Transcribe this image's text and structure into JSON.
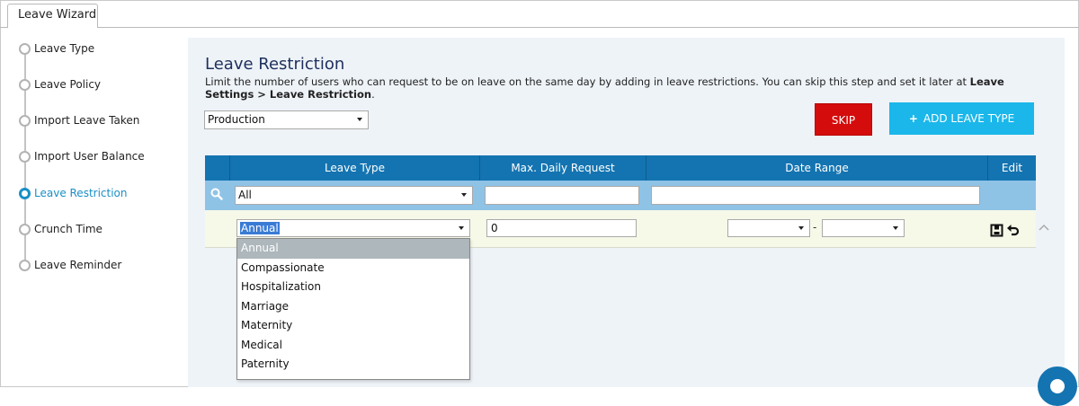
{
  "tab": {
    "label": "Leave Wizard"
  },
  "steps": [
    {
      "label": "Leave Type",
      "active": false
    },
    {
      "label": "Leave Policy",
      "active": false
    },
    {
      "label": "Import Leave Taken",
      "active": false
    },
    {
      "label": "Import User Balance",
      "active": false
    },
    {
      "label": "Leave Restriction",
      "active": true
    },
    {
      "label": "Crunch Time",
      "active": false
    },
    {
      "label": "Leave Reminder",
      "active": false
    }
  ],
  "main": {
    "title": "Leave Restriction",
    "description_prefix": "Limit the number of users who can request to be on leave on the same day by adding in leave restrictions. You can skip this step and set it later at ",
    "description_bold": "Leave Settings > Leave Restriction",
    "description_suffix": ".",
    "department_select": "Production",
    "skip_label": "SKIP",
    "add_label": "ADD LEAVE TYPE"
  },
  "table": {
    "columns": [
      "Leave Type",
      "Max. Daily Request",
      "Date Range",
      "Edit"
    ],
    "filter": {
      "leave_type": "All",
      "max_daily": "",
      "date_range": ""
    },
    "edit_row": {
      "leave_type": "Annual",
      "max_daily": "0",
      "from": "",
      "separator": "-",
      "to": ""
    }
  },
  "dropdown_options": [
    "Annual",
    "Compassionate",
    "Hospitalization",
    "Marriage",
    "Maternity",
    "Medical",
    "Paternity"
  ],
  "colors": {
    "header": "#1474b1",
    "filter_row": "#8fc3e6",
    "skip": "#d40c0c",
    "add": "#1bb7ea",
    "active_step": "#1a8fc6"
  }
}
